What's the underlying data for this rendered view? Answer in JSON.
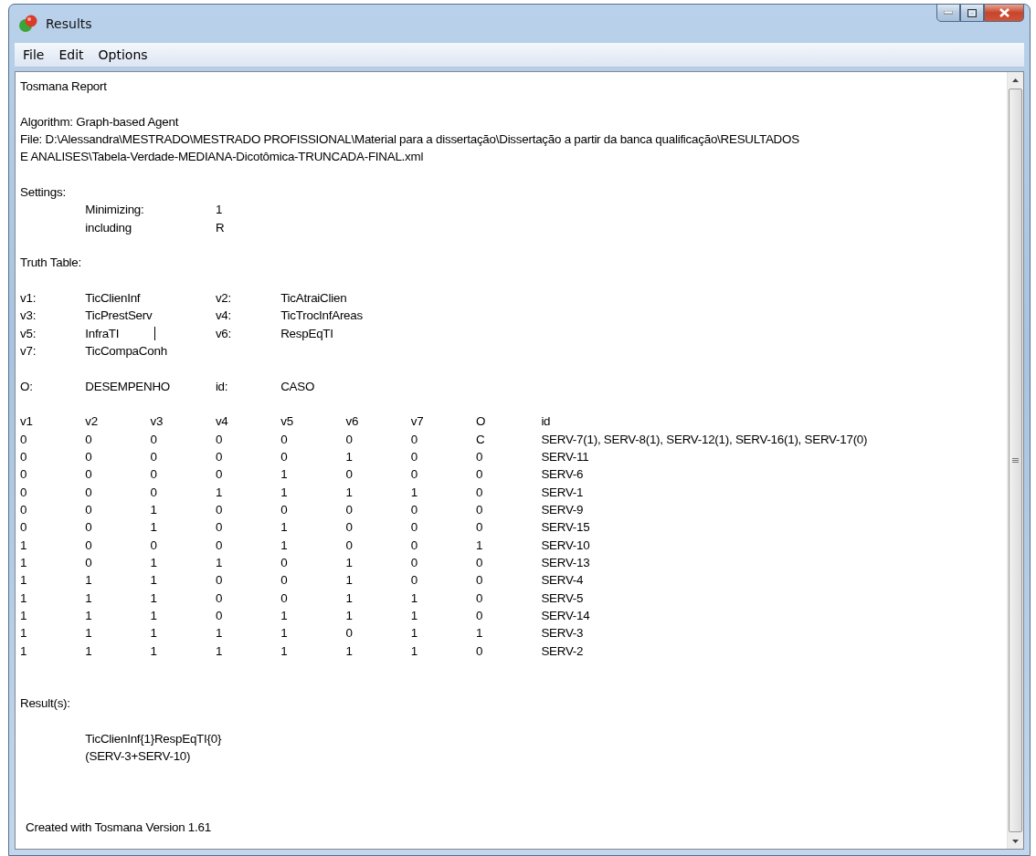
{
  "window": {
    "title": "Results"
  },
  "menu": [
    "File",
    "Edit",
    "Options"
  ],
  "report": {
    "title": "Tosmana Report",
    "algorithm": "Algorithm: Graph-based Agent",
    "file_lines": [
      "File: D:\\Alessandra\\MESTRADO\\MESTRADO PROFISSIONAL\\Material para a dissertação\\Dissertação a partir da banca qualificação\\RESULTADOS",
      "E ANALISES\\Tabela-Verdade-MEDIANA-Dicotômica-TRUNCADA-FINAL.xml"
    ],
    "settings_label": "Settings:",
    "settings": [
      {
        "label": "Minimizing:",
        "value": "1"
      },
      {
        "label": "including",
        "value": "R"
      }
    ],
    "truth_table_label": "Truth Table:",
    "variables": [
      {
        "code": "v1:",
        "name": "TicClienInf"
      },
      {
        "code": "v2:",
        "name": "TicAtraiClien"
      },
      {
        "code": "v3:",
        "name": "TicPrestServ"
      },
      {
        "code": "v4:",
        "name": "TicTrocInfAreas"
      },
      {
        "code": "v5:",
        "name": "InfraTI"
      },
      {
        "code": "v6:",
        "name": "RespEqTI"
      },
      {
        "code": "v7:",
        "name": "TicCompaConh"
      }
    ],
    "outcome": {
      "label": "O:",
      "value": "DESEMPENHO",
      "id_label": "id:",
      "id_value": "CASO"
    },
    "table": {
      "columns": [
        "v1",
        "v2",
        "v3",
        "v4",
        "v5",
        "v6",
        "v7",
        "O",
        "id"
      ],
      "rows": [
        [
          "0",
          "0",
          "0",
          "0",
          "0",
          "0",
          "0",
          "C",
          "SERV-7(1), SERV-8(1), SERV-12(1), SERV-16(1), SERV-17(0)"
        ],
        [
          "0",
          "0",
          "0",
          "0",
          "0",
          "1",
          "0",
          "0",
          "SERV-11"
        ],
        [
          "0",
          "0",
          "0",
          "0",
          "1",
          "0",
          "0",
          "0",
          "SERV-6"
        ],
        [
          "0",
          "0",
          "0",
          "1",
          "1",
          "1",
          "1",
          "0",
          "SERV-1"
        ],
        [
          "0",
          "0",
          "1",
          "0",
          "0",
          "0",
          "0",
          "0",
          "SERV-9"
        ],
        [
          "0",
          "0",
          "1",
          "0",
          "1",
          "0",
          "0",
          "0",
          "SERV-15"
        ],
        [
          "1",
          "0",
          "0",
          "0",
          "1",
          "0",
          "0",
          "1",
          "SERV-10"
        ],
        [
          "1",
          "0",
          "1",
          "1",
          "0",
          "1",
          "0",
          "0",
          "SERV-13"
        ],
        [
          "1",
          "1",
          "1",
          "0",
          "0",
          "1",
          "0",
          "0",
          "SERV-4"
        ],
        [
          "1",
          "1",
          "1",
          "0",
          "0",
          "1",
          "1",
          "0",
          "SERV-5"
        ],
        [
          "1",
          "1",
          "1",
          "0",
          "1",
          "1",
          "1",
          "0",
          "SERV-14"
        ],
        [
          "1",
          "1",
          "1",
          "1",
          "1",
          "0",
          "1",
          "1",
          "SERV-3"
        ],
        [
          "1",
          "1",
          "1",
          "1",
          "1",
          "1",
          "1",
          "0",
          "SERV-2"
        ]
      ]
    },
    "results_label": "Result(s):",
    "results": [
      "TicClienInf{1}RespEqTI{0}",
      "(SERV-3+SERV-10)"
    ],
    "footer": "Created with Tosmana Version 1.61"
  }
}
